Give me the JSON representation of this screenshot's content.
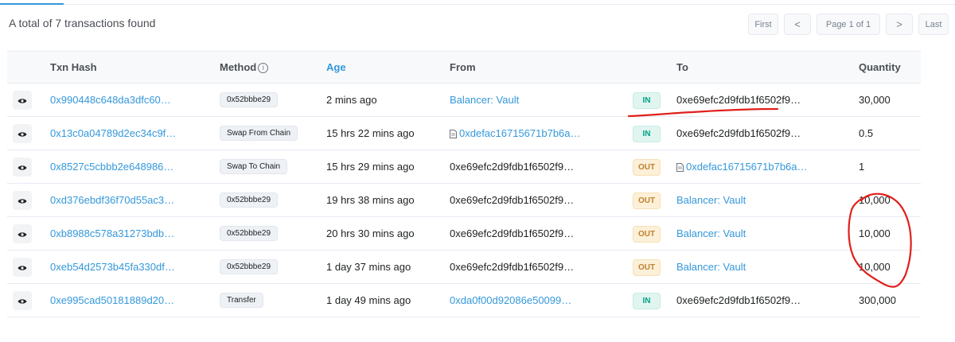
{
  "summary": "A total of 7 transactions found",
  "pager": {
    "first": "First",
    "prev": "<",
    "page": "Page 1 of 1",
    "next": ">",
    "last": "Last"
  },
  "columns": {
    "hash": "Txn Hash",
    "method": "Method",
    "age": "Age",
    "from": "From",
    "to": "To",
    "quantity": "Quantity"
  },
  "rows": [
    {
      "hash": "0x990448c648da3dfc60…",
      "method": "0x52bbbe29",
      "age": "2 mins ago",
      "from": "Balancer: Vault",
      "dir": "IN",
      "to": "0xe69efc2d9fdb1f6502f9…",
      "qty": "30,000"
    },
    {
      "hash": "0x13c0a04789d2ec34c9f…",
      "method": "Swap From Chain",
      "age": "15 hrs 22 mins ago",
      "from": "0xdefac16715671b7b6a…",
      "dir": "IN",
      "to": "0xe69efc2d9fdb1f6502f9…",
      "qty": "0.5"
    },
    {
      "hash": "0x8527c5cbbb2e648986…",
      "method": "Swap To Chain",
      "age": "15 hrs 29 mins ago",
      "from": "0xe69efc2d9fdb1f6502f9…",
      "dir": "OUT",
      "to": "0xdefac16715671b7b6a…",
      "qty": "1"
    },
    {
      "hash": "0xd376ebdf36f70d55ac3…",
      "method": "0x52bbbe29",
      "age": "19 hrs 38 mins ago",
      "from": "0xe69efc2d9fdb1f6502f9…",
      "dir": "OUT",
      "to": "Balancer: Vault",
      "qty": "10,000"
    },
    {
      "hash": "0xb8988c578a31273bdb…",
      "method": "0x52bbbe29",
      "age": "20 hrs 30 mins ago",
      "from": "0xe69efc2d9fdb1f6502f9…",
      "dir": "OUT",
      "to": "Balancer: Vault",
      "qty": "10,000"
    },
    {
      "hash": "0xeb54d2573b45fa330df…",
      "method": "0x52bbbe29",
      "age": "1 day 37 mins ago",
      "from": "0xe69efc2d9fdb1f6502f9…",
      "dir": "OUT",
      "to": "Balancer: Vault",
      "qty": "10,000"
    },
    {
      "hash": "0xe995cad50181889d20…",
      "method": "Transfer",
      "age": "1 day 49 mins ago",
      "from": "0xda0f00d92086e50099…",
      "dir": "IN",
      "to": "0xe69efc2d9fdb1f6502f9…",
      "qty": "300,000"
    }
  ],
  "colors": {
    "link": "#3498db",
    "in": "#00a186",
    "out": "#c0812b",
    "annotation": "#e0201b"
  },
  "icons": {
    "view": "eye-icon",
    "contract": "document-icon",
    "info": "info-icon"
  }
}
